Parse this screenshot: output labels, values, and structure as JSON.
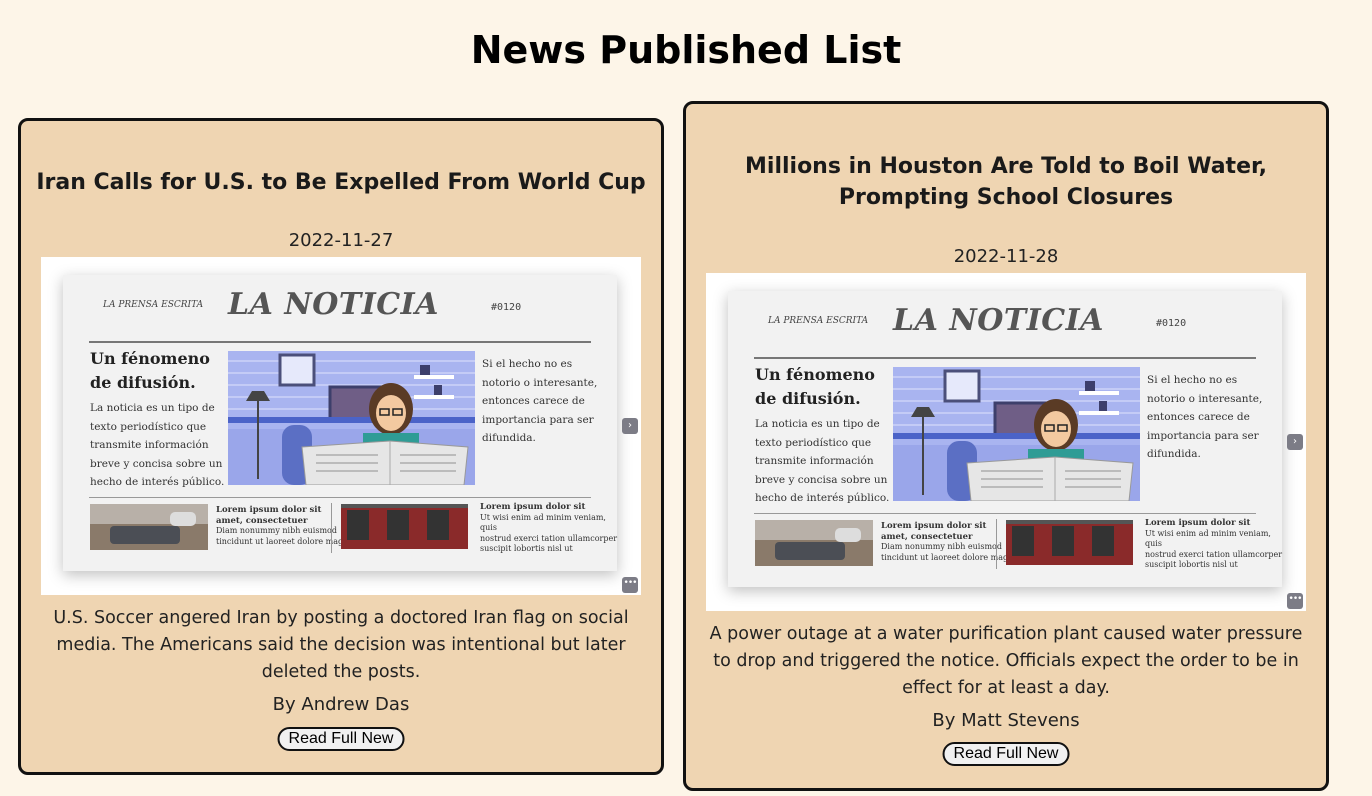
{
  "page": {
    "title": "News Published List"
  },
  "colors": {
    "background": "#fdf5e8",
    "card": "#efd5b2",
    "border": "#111111"
  },
  "articles": [
    {
      "title": "Iran Calls for U.S. to Be Expelled From World Cup",
      "date": "2022-11-27",
      "description": "U.S. Soccer angered Iran by posting a doctored Iran flag on social media. The Americans said the decision was intentional but later deleted the posts.",
      "author": "By Andrew Das",
      "button": "Read Full New"
    },
    {
      "title": "Millions in Houston Are Told to Boil Water, Prompting School Closures",
      "date": "2022-11-28",
      "description": "A power outage at a water purification plant caused water pressure to drop and triggered the notice. Officials expect the order to be in effect for at least a day.",
      "author": "By Matt Stevens",
      "button": "Read Full New"
    }
  ],
  "newspaper": {
    "top_label": "LA PRENSA ESCRITA",
    "masthead": "LA NOTICIA",
    "issue": "#0120",
    "headline_1": "Un fénomeno",
    "headline_2": "de difusión.",
    "body_1": "La noticia es un tipo de",
    "body_2": "texto periodístico que",
    "body_3": "transmite información",
    "body_4": "breve y concisa sobre un",
    "body_5": "hecho de interés público.",
    "right_1": "Si el hecho no es",
    "right_2": "notorio o interesante,",
    "right_3": "entonces carece de",
    "right_4": "importancia para ser",
    "right_5": "difundida.",
    "cap1_1": "Lorem ipsum dolor sit",
    "cap1_2": "amet, consectetuer",
    "cap1_3": "Diam nonummy nibh euismod",
    "cap1_4": "tincidunt ut laoreet dolore magna.",
    "cap2_1": "Lorem ipsum dolor sit",
    "cap2_2": "Ut wisi enim ad minim veniam, quis",
    "cap2_3": "nostrud exerci tation ullamcorper",
    "cap2_4": "suscipit lobortis nisl ut"
  },
  "icons": {
    "next": "chevron-right-icon",
    "more": "more-dots-icon"
  }
}
